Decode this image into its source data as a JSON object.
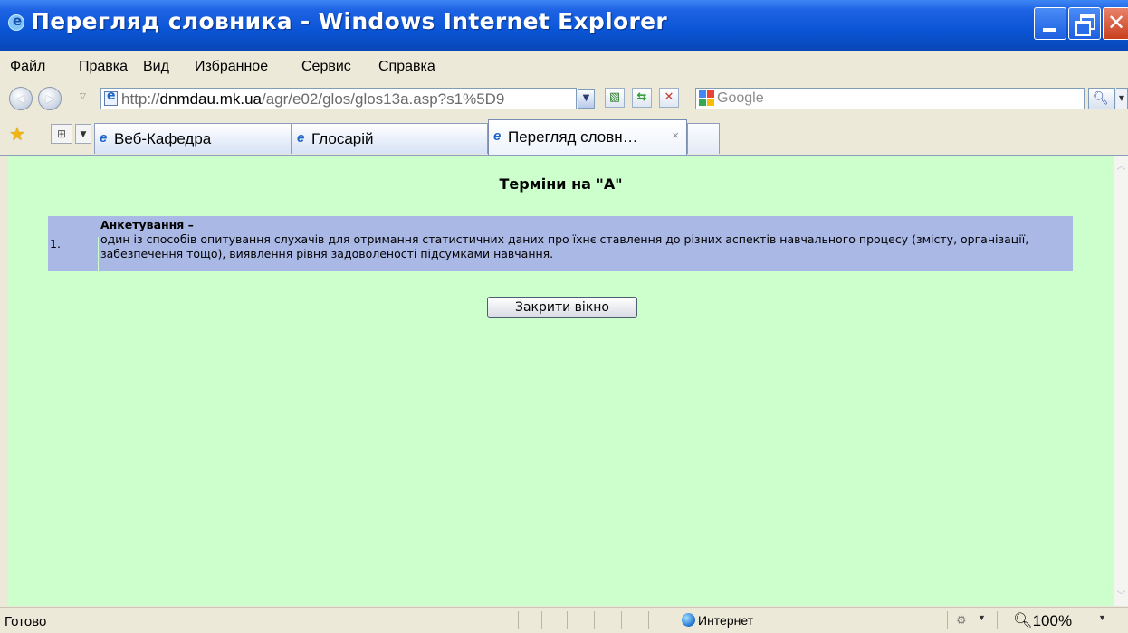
{
  "window": {
    "title": "Перегляд словника - Windows Internet Explorer",
    "colors": {
      "titlebar": "#0a55d6",
      "content_bg": "#ccffcc",
      "table_bg": "#aab8e6"
    }
  },
  "menu": {
    "items": [
      "Файл",
      "Правка",
      "Вид",
      "Избранное",
      "Сервис",
      "Справка"
    ]
  },
  "address": {
    "url_prefix": "http://",
    "url_domain": "dnmdau.mk.ua",
    "url_path": "/agr/e02/glos/glos13a.asp?s1%5D9",
    "search_placeholder": "Google"
  },
  "tabs": [
    {
      "label": "Веб-Кафедра",
      "active": false
    },
    {
      "label": "Глосарій",
      "active": false
    },
    {
      "label": "Перегляд словн…",
      "active": true,
      "close": "×"
    }
  ],
  "page": {
    "heading": "Терміни на \"А\"",
    "terms": [
      {
        "number": "1.",
        "name": "Анкетування –",
        "definition": "один із способів опитування слухачів для отримання статистичних даних про їхнє ставлення до різних аспектів навчального процесу (змісту, організації, забезпечення тощо), виявлення рівня задоволеності підсумками навчання."
      }
    ],
    "close_button": "Закрити вікно"
  },
  "status": {
    "text": "Готово",
    "zone": "Интернет",
    "zoom": "100%"
  }
}
